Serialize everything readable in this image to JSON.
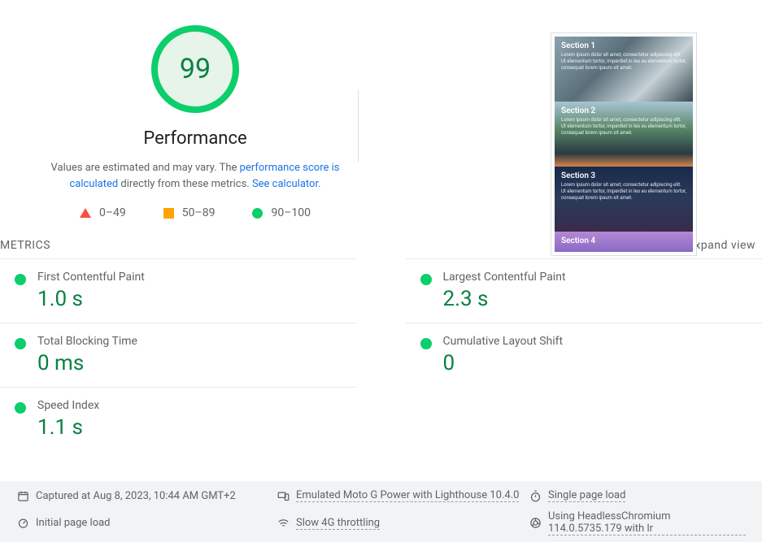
{
  "score": {
    "value": "99",
    "title": "Performance",
    "desc_prefix": "Values are estimated and may vary. The ",
    "desc_link1": "performance score is calculated",
    "desc_mid": " directly from these metrics. ",
    "desc_link2": "See calculator."
  },
  "legend": {
    "fail": "0–49",
    "avg": "50–89",
    "pass": "90–100"
  },
  "preview": {
    "sections": [
      {
        "title": "Section 1"
      },
      {
        "title": "Section 2"
      },
      {
        "title": "Section 3"
      },
      {
        "title": "Section 4"
      }
    ],
    "lorem": "Lorem ipsum dolor sit amet, consectetur adipiscing elit. Ut elementum tortor, imperdiet in leo eu elementum tortor, consequat lorem ipsum sit amet."
  },
  "metrics_header": {
    "label": "METRICS",
    "expand": "Expand view"
  },
  "metrics": [
    {
      "name": "First Contentful Paint",
      "value": "1.0 s"
    },
    {
      "name": "Largest Contentful Paint",
      "value": "2.3 s"
    },
    {
      "name": "Total Blocking Time",
      "value": "0 ms"
    },
    {
      "name": "Cumulative Layout Shift",
      "value": "0"
    },
    {
      "name": "Speed Index",
      "value": "1.1 s"
    }
  ],
  "env": {
    "captured": "Captured at Aug 8, 2023, 10:44 AM GMT+2",
    "device": "Emulated Moto G Power with Lighthouse 10.4.0",
    "load": "Single page load",
    "initial": "Initial page load",
    "throttle": "Slow 4G throttling",
    "browser": "Using HeadlessChromium 114.0.5735.179 with lr"
  }
}
